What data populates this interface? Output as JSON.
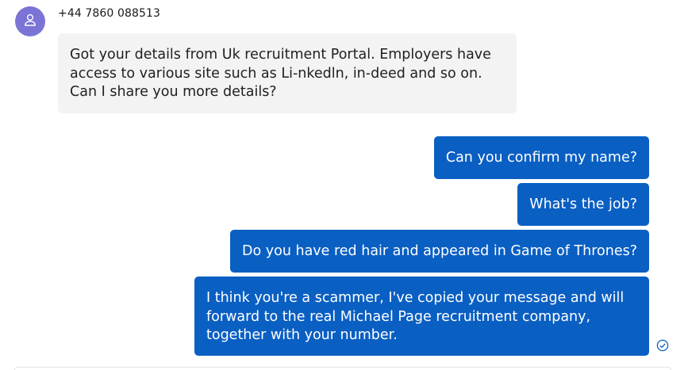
{
  "conversation": {
    "contact_number": "+44 7860 088513",
    "icons": {
      "avatar": "person-icon",
      "read_receipt": "check-circle-icon"
    },
    "colors": {
      "avatar_bg": "#7b74d6",
      "incoming_bubble": "#f3f3f3",
      "outgoing_bubble": "#0a5fc3",
      "read_receipt": "#0a5fc3"
    },
    "messages": [
      {
        "direction": "incoming",
        "text": "Got your details from Uk recruitment Portal. Employers have access to various site such as Li-nkedln, in-deed and so on. Can I share you more details?"
      },
      {
        "direction": "outgoing",
        "text": "Can you confirm my name?"
      },
      {
        "direction": "outgoing",
        "text": "What's the job?"
      },
      {
        "direction": "outgoing",
        "text": "Do you have red hair and appeared in Game of Thrones?"
      },
      {
        "direction": "outgoing",
        "text": "I think you're a scammer, I've copied your message and will forward to the real Michael Page recruitment company, together with your number."
      }
    ]
  }
}
